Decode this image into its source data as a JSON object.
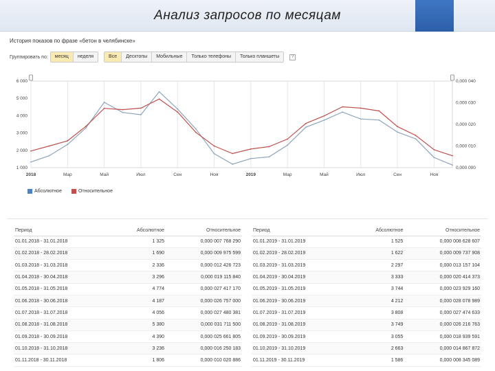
{
  "slide": {
    "title": "Анализ запросов по месяцам"
  },
  "history": {
    "title": "История показов по фразе «бетон в челябинске»",
    "group_label": "Группировать по:",
    "group_options": [
      "месяц",
      "неделя"
    ],
    "group_selected": "месяц",
    "device_tabs": [
      "Все",
      "Десктопы",
      "Мобильные",
      "Только телефоны",
      "Только планшеты"
    ],
    "device_selected": "Все",
    "help_glyph": "?"
  },
  "colors": {
    "absolute": "#8da3bd",
    "relative": "#c0504d",
    "legend_absolute": "#4f81bd",
    "legend_relative": "#c0504d",
    "header_accent": "#3f76c4"
  },
  "chart_data": {
    "type": "line",
    "x": [
      "2018-01",
      "2018-02",
      "2018-03",
      "2018-04",
      "2018-05",
      "2018-06",
      "2018-07",
      "2018-08",
      "2018-09",
      "2018-10",
      "2018-11",
      "2018-12",
      "2019-01",
      "2019-02",
      "2019-03",
      "2019-04",
      "2019-05",
      "2019-06",
      "2019-07",
      "2019-08",
      "2019-09",
      "2019-10",
      "2019-11",
      "2019-12"
    ],
    "xtick_labels": [
      "2018",
      "Мар",
      "Май",
      "Июл",
      "Сен",
      "Ноя",
      "2019",
      "Мар",
      "Май",
      "Июл",
      "Сен",
      "Ноя"
    ],
    "xtick_index": [
      0,
      2,
      4,
      6,
      8,
      10,
      12,
      14,
      16,
      18,
      20,
      22
    ],
    "y_left_ticks": [
      "1 000",
      "2 000",
      "3 000",
      "4 000",
      "5 000",
      "6 000"
    ],
    "y_left_range": [
      1000,
      6000
    ],
    "y_right_ticks": [
      "0,000 000",
      "0,000 010",
      "0,000 020",
      "0,000 030",
      "0,000 040"
    ],
    "y_right_range": [
      0,
      4e-05
    ],
    "series": [
      {
        "name": "Абсолютное",
        "axis": "left",
        "values": [
          1325,
          1690,
          2336,
          3296,
          4774,
          4187,
          4056,
          5380,
          4390,
          3236,
          1806,
          1200,
          1525,
          1622,
          2297,
          3333,
          3744,
          4212,
          3808,
          3749,
          3055,
          2663,
          1586,
          1150
        ]
      },
      {
        "name": "Относительное",
        "axis": "right",
        "values": [
          7.7e-06,
          1e-05,
          1.24e-05,
          1.91e-05,
          2.74e-05,
          2.68e-05,
          2.75e-05,
          3.17e-05,
          2.57e-05,
          1.63e-05,
          1e-05,
          6.5e-06,
          8.6e-06,
          9.7e-06,
          1.32e-05,
          2.04e-05,
          2.39e-05,
          2.81e-05,
          2.75e-05,
          2.62e-05,
          1.9e-05,
          1.49e-05,
          8.3e-06,
          5.5e-06
        ]
      }
    ],
    "grid": "vertical",
    "legend": "bottom-left"
  },
  "table": {
    "headers": {
      "period": "Период",
      "absolute": "Абсолютное",
      "relative": "Относительное"
    },
    "left": [
      {
        "period": "01.01.2018 - 31.01.2018",
        "absolute": "1 325",
        "relative": "0,000 007 768 290"
      },
      {
        "period": "01.02.2018 - 28.02.2018",
        "absolute": "1 690",
        "relative": "0,000 009 975 599"
      },
      {
        "period": "01.03.2018 - 31.03.2018",
        "absolute": "2 336",
        "relative": "0,000 012 426 723"
      },
      {
        "period": "01.04.2018 - 30.04.2018",
        "absolute": "3 296",
        "relative": "0,000 019 115 840"
      },
      {
        "period": "01.05.2018 - 31.05.2018",
        "absolute": "4 774",
        "relative": "0,000 027 417 170"
      },
      {
        "period": "01.06.2018 - 30.06.2018",
        "absolute": "4 187",
        "relative": "0,000 026 757 000"
      },
      {
        "period": "01.07.2018 - 31.07.2018",
        "absolute": "4 056",
        "relative": "0,000 027 480 381"
      },
      {
        "period": "01.08.2018 - 31.08.2018",
        "absolute": "5 380",
        "relative": "0,000 031 711 500"
      },
      {
        "period": "01.09.2018 - 30.09.2018",
        "absolute": "4 390",
        "relative": "0,000 025 661 805"
      },
      {
        "period": "01.10.2018 - 31.10.2018",
        "absolute": "3 236",
        "relative": "0,000 016 250 183"
      },
      {
        "period": "01.11.2018 - 30.11.2018",
        "absolute": "1 806",
        "relative": "0,000 010 020 886"
      }
    ],
    "right": [
      {
        "period": "01.01.2019 - 31.01.2019",
        "absolute": "1 525",
        "relative": "0,000 008 628 607"
      },
      {
        "period": "01.02.2019 - 28.02.2019",
        "absolute": "1 622",
        "relative": "0,000 009 737 908"
      },
      {
        "period": "01.03.2019 - 31.03.2019",
        "absolute": "2 297",
        "relative": "0,000 013 157 104"
      },
      {
        "period": "01.04.2019 - 30.04.2019",
        "absolute": "3 333",
        "relative": "0,000 020 414 373"
      },
      {
        "period": "01.05.2019 - 31.05.2019",
        "absolute": "3 744",
        "relative": "0,000 023 929 160"
      },
      {
        "period": "01.06.2019 - 30.06.2019",
        "absolute": "4 212",
        "relative": "0,000 028 078 989"
      },
      {
        "period": "01.07.2019 - 31.07.2019",
        "absolute": "3 808",
        "relative": "0,000 027 474 633"
      },
      {
        "period": "01.08.2019 - 31.08.2019",
        "absolute": "3 749",
        "relative": "0,000 026 216 763"
      },
      {
        "period": "01.09.2019 - 30.09.2019",
        "absolute": "3 055",
        "relative": "0,000 018 939 591"
      },
      {
        "period": "01.10.2019 - 31.10.2019",
        "absolute": "2 663",
        "relative": "0,000 014 867 872"
      },
      {
        "period": "01.11.2019 - 30.11.2019",
        "absolute": "1 586",
        "relative": "0,000 008 345 089"
      }
    ]
  }
}
